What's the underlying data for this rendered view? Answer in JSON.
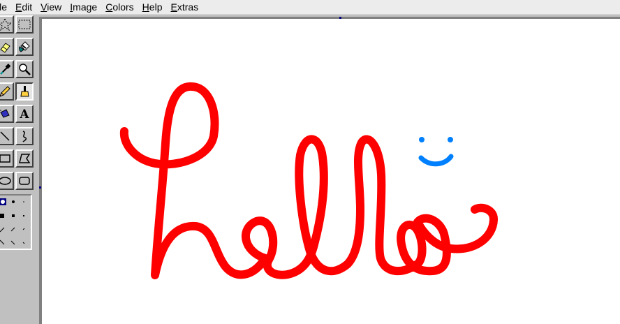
{
  "menu": {
    "items": [
      {
        "id": "file",
        "mnemonic": "",
        "rest": "ile"
      },
      {
        "id": "edit",
        "mnemonic": "E",
        "rest": "dit"
      },
      {
        "id": "view",
        "mnemonic": "V",
        "rest": "iew"
      },
      {
        "id": "image",
        "mnemonic": "I",
        "rest": "mage"
      },
      {
        "id": "colors",
        "mnemonic": "C",
        "rest": "olors"
      },
      {
        "id": "help",
        "mnemonic": "H",
        "rest": "elp"
      },
      {
        "id": "extras",
        "mnemonic": "E",
        "rest": "xtras"
      }
    ]
  },
  "toolbox": {
    "tools": [
      {
        "name": "free-form-select-tool",
        "icon": "star-select-icon"
      },
      {
        "name": "rectangle-select-tool",
        "icon": "rect-select-icon"
      },
      {
        "name": "eraser-tool",
        "icon": "eraser-icon"
      },
      {
        "name": "fill-tool",
        "icon": "paint-bucket-icon"
      },
      {
        "name": "color-picker-tool",
        "icon": "eyedropper-icon"
      },
      {
        "name": "magnifier-tool",
        "icon": "magnifier-icon"
      },
      {
        "name": "pencil-tool",
        "icon": "pencil-icon"
      },
      {
        "name": "brush-tool",
        "icon": "brush-icon",
        "selected": true
      },
      {
        "name": "airbrush-tool",
        "icon": "airbrush-icon"
      },
      {
        "name": "text-tool",
        "icon": "text-icon",
        "label": "A"
      },
      {
        "name": "line-tool",
        "icon": "line-icon"
      },
      {
        "name": "curve-tool",
        "icon": "curve-icon"
      },
      {
        "name": "rectangle-tool",
        "icon": "rectangle-icon"
      },
      {
        "name": "polygon-tool",
        "icon": "polygon-icon"
      },
      {
        "name": "ellipse-tool",
        "icon": "ellipse-icon"
      },
      {
        "name": "rounded-rectangle-tool",
        "icon": "rounded-rectangle-icon"
      }
    ],
    "brush_options": "brush-shape-options"
  },
  "canvas": {
    "background": "#ffffff",
    "stroke_colors": {
      "hello": "#ff0000",
      "smiley": "#0080ff"
    }
  },
  "colors": {
    "menubar_bg": "#ececec",
    "face": "#c0c0c0",
    "workspace": "#808080"
  }
}
